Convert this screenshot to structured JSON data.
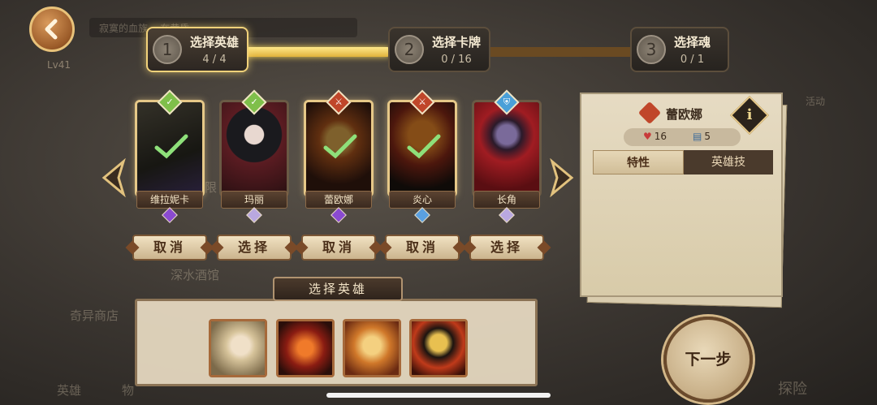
{
  "background": {
    "top_ghost_text": "寂寞的血族... 在黄昏",
    "level": "Lv41",
    "ghost_labels": [
      "深水酒馆",
      "奇异商店",
      "英雄",
      "物",
      "探险",
      "活动",
      "限"
    ]
  },
  "stepper": {
    "steps": [
      {
        "num": "1",
        "title": "选择英雄",
        "count": "4 / 4",
        "active": true
      },
      {
        "num": "2",
        "title": "选择卡牌",
        "count": "0 / 16",
        "active": false
      },
      {
        "num": "3",
        "title": "选择魂",
        "count": "0 / 1",
        "active": false
      }
    ]
  },
  "heroes": [
    {
      "name": "维拉妮卡",
      "action": "取消",
      "selected": true,
      "class_icon": "check-class-icon",
      "class_color": "#7fbf4a",
      "rarity_color": "#8a4ad0"
    },
    {
      "name": "玛丽",
      "action": "选择",
      "selected": false,
      "class_icon": "check-class-icon",
      "class_color": "#7fbf4a",
      "rarity_color": "#b9a8e0"
    },
    {
      "name": "蕾欧娜",
      "action": "取消",
      "selected": true,
      "class_icon": "sword-class-icon",
      "class_color": "#c0462a",
      "rarity_color": "#8a4ad0"
    },
    {
      "name": "炎心",
      "action": "取消",
      "selected": true,
      "class_icon": "sword-class-icon",
      "class_color": "#c0462a",
      "rarity_color": "#5aa0e0"
    },
    {
      "name": "长角",
      "action": "选择",
      "selected": false,
      "class_icon": "shield-class-icon",
      "class_color": "#4aa0d8",
      "rarity_color": "#b9a8e0"
    }
  ],
  "detail": {
    "name": "蕾欧娜",
    "info_label": "i",
    "hp": "16",
    "cards": "5",
    "tabs": [
      "特性",
      "英雄技"
    ]
  },
  "select_strip": {
    "title": "选择英雄",
    "thumbs": [
      "维拉妮卡",
      "炎心",
      "蕾欧娜",
      "炎心2"
    ]
  },
  "next_button": "下一步",
  "colors": {
    "accent_gold": "#f2d27a",
    "progress_fill": "#e0b23b"
  }
}
